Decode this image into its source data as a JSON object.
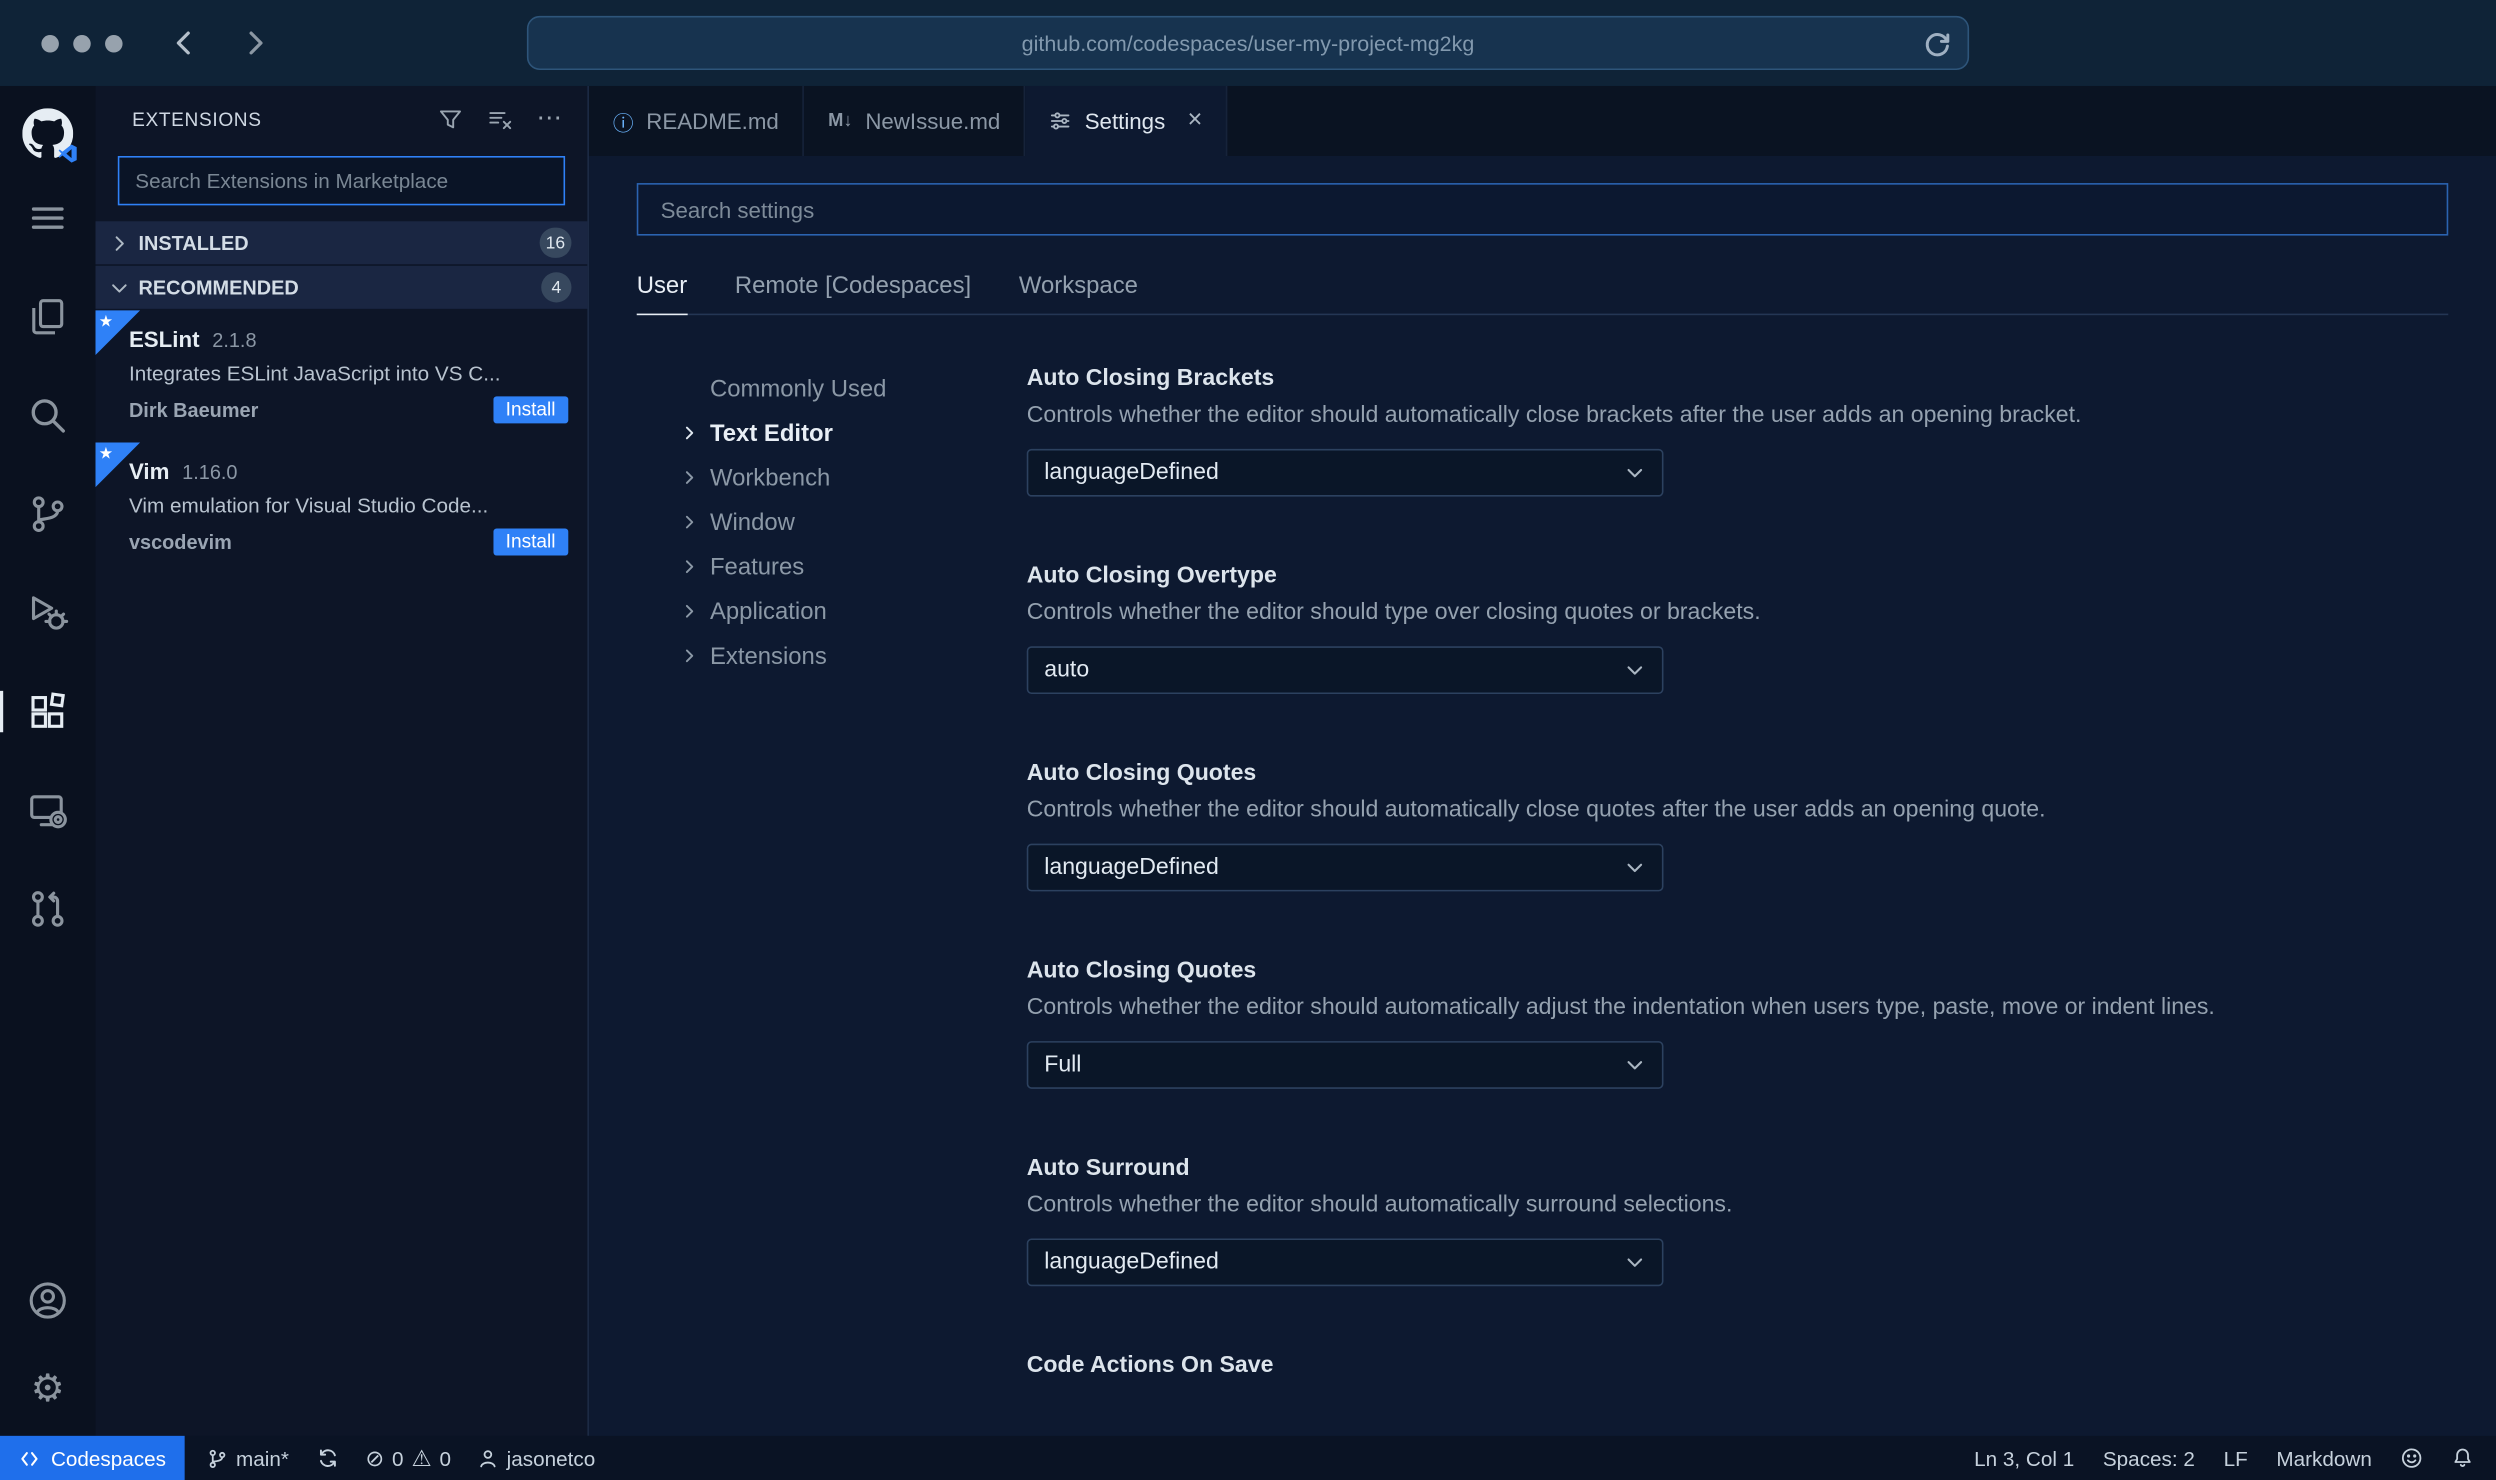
{
  "colors": {
    "accent": "#2f81f7",
    "codespaces_blue": "#1f6feb"
  },
  "icons": {
    "gear": "⚙",
    "ellipsis": "⋯",
    "star": "★",
    "info": "ⓘ",
    "markdown": "M↓",
    "close": "×",
    "error": "⊘",
    "warning": "⚠"
  },
  "chrome": {
    "url": "github.com/codespaces/user-my-project-mg2kg"
  },
  "sidebar": {
    "title": "EXTENSIONS",
    "search_placeholder": "Search Extensions in Marketplace",
    "sections": [
      {
        "label": "INSTALLED",
        "count": "16"
      },
      {
        "label": "RECOMMENDED",
        "count": "4"
      }
    ],
    "extensions": [
      {
        "name": "ESLint",
        "version": "2.1.8",
        "description": "Integrates ESLint JavaScript into VS C...",
        "author": "Dirk Baeumer",
        "action": "Install"
      },
      {
        "name": "Vim",
        "version": "1.16.0",
        "description": "Vim emulation for Visual Studio Code...",
        "author": "vscodevim",
        "action": "Install"
      }
    ]
  },
  "tabs": [
    {
      "label": "README.md"
    },
    {
      "label": "NewIssue.md"
    },
    {
      "label": "Settings"
    }
  ],
  "settings": {
    "search_placeholder": "Search settings",
    "scopes": [
      {
        "label": "User"
      },
      {
        "label": "Remote [Codespaces]"
      },
      {
        "label": "Workspace"
      }
    ],
    "toc": [
      {
        "label": "Commonly Used"
      },
      {
        "label": "Text Editor"
      },
      {
        "label": "Workbench"
      },
      {
        "label": "Window"
      },
      {
        "label": "Features"
      },
      {
        "label": "Application"
      },
      {
        "label": "Extensions"
      }
    ],
    "items": [
      {
        "title": "Auto Closing Brackets",
        "description": "Controls whether the editor should automatically close brackets after the user adds an opening bracket.",
        "value": "languageDefined"
      },
      {
        "title": "Auto Closing Overtype",
        "description": "Controls whether the editor should type over closing quotes or brackets.",
        "value": "auto"
      },
      {
        "title": "Auto Closing Quotes",
        "description": "Controls whether the editor should automatically close quotes after the user adds an opening quote.",
        "value": "languageDefined"
      },
      {
        "title": "Auto Closing Quotes",
        "description": "Controls whether the editor should automatically adjust the indentation when users type, paste, move or indent lines.",
        "value": "Full"
      },
      {
        "title": "Auto Surround",
        "description": "Controls whether the editor should automatically surround selections.",
        "value": "languageDefined"
      },
      {
        "title": "Code Actions On Save"
      }
    ]
  },
  "status_bar": {
    "codespaces": "Codespaces",
    "branch": "main*",
    "errors": "0",
    "warnings": "0",
    "user": "jasonetco",
    "line_col": "Ln 3, Col 1",
    "spaces": "Spaces: 2",
    "eol": "LF",
    "language": "Markdown"
  }
}
